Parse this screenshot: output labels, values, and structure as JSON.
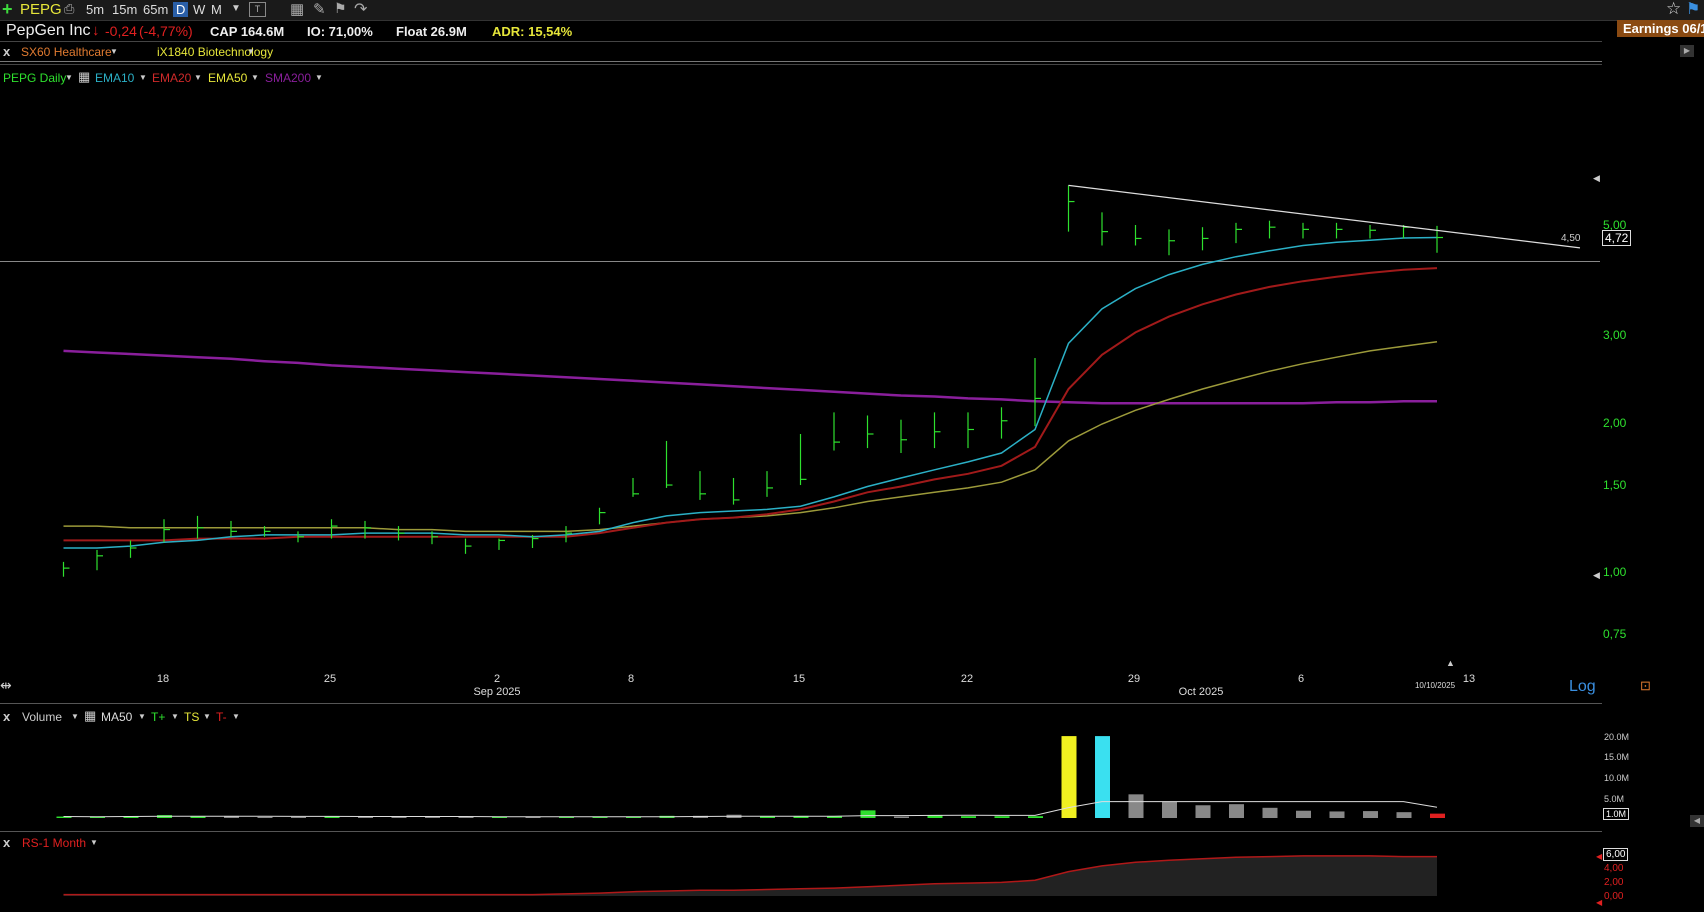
{
  "toolbar": {
    "symbol": "PEPG",
    "intervals": [
      "5m",
      "15m",
      "65m",
      "D",
      "W",
      "M"
    ],
    "active_interval": "D"
  },
  "header": {
    "company": "PepGen Inc",
    "change": "-0,24",
    "change_pct": "(-4,77%)",
    "cap": "CAP 164.6M",
    "io": "IO: 71,00%",
    "float": "Float 26.9M",
    "adr": "ADR: 15,54%",
    "earnings": "Earnings 06/1"
  },
  "sectors": {
    "close": "x",
    "sector": "SX60 Healthcare",
    "industry": "iX1840 Biotechnology"
  },
  "indicators": {
    "main": "PEPG Daily",
    "ema10": "EMA10",
    "ema20": "EMA20",
    "ema50": "EMA50",
    "sma200": "SMA200"
  },
  "price_axis": {
    "ticks": [
      "5,00",
      "3,00",
      "2,00",
      "1,50",
      "1,00",
      "0,75"
    ],
    "last_price": "4,72",
    "trendline_label": "4,50",
    "scale": "Log"
  },
  "date_axis": {
    "ticks": [
      "18",
      "25",
      "2",
      "8",
      "15",
      "22",
      "29",
      "6",
      "13"
    ],
    "months": [
      "Sep 2025",
      "Oct 2025"
    ],
    "cursor_date": "10/10/2025"
  },
  "volume_panel": {
    "close": "x",
    "title": "Volume",
    "ma": "MA50",
    "t_plus": "T+",
    "ts": "TS",
    "t_minus": "T-",
    "ticks": [
      "20.0M",
      "15.0M",
      "10.0M",
      "5.0M"
    ],
    "last_volume": "1.0M"
  },
  "rs_panel": {
    "close": "x",
    "title": "RS-1 Month",
    "ticks": [
      "4,00",
      "2,00",
      "0,00"
    ],
    "last_value": "6,00"
  },
  "colors": {
    "bar": "#2ee02e",
    "ema10": "#2bb0c6",
    "ema20": "#a11a1a",
    "ema50": "#9c9a3a",
    "sma200": "#8a1f9c"
  },
  "chart_data": {
    "type": "ohlc",
    "title": "PEPG Daily",
    "y_scale": "log",
    "ylim": [
      0.65,
      6.5
    ],
    "dates": [
      "Aug 13",
      "Aug 14",
      "Aug 15",
      "Aug 18",
      "Aug 19",
      "Aug 20",
      "Aug 21",
      "Aug 22",
      "Aug 25",
      "Aug 26",
      "Aug 27",
      "Aug 28",
      "Aug 29",
      "Sep 2",
      "Sep 3",
      "Sep 4",
      "Sep 5",
      "Sep 8",
      "Sep 9",
      "Sep 10",
      "Sep 11",
      "Sep 12",
      "Sep 15",
      "Sep 16",
      "Sep 17",
      "Sep 18",
      "Sep 19",
      "Sep 22",
      "Sep 23",
      "Sep 24",
      "Sep 25",
      "Sep 26",
      "Sep 29",
      "Sep 30",
      "Oct 1",
      "Oct 2",
      "Oct 3",
      "Oct 6",
      "Oct 7",
      "Oct 8",
      "Oct 9",
      "Oct 10"
    ],
    "high": [
      1.06,
      1.12,
      1.17,
      1.29,
      1.31,
      1.28,
      1.25,
      1.22,
      1.29,
      1.28,
      1.25,
      1.22,
      1.18,
      1.18,
      1.2,
      1.25,
      1.36,
      1.56,
      1.85,
      1.61,
      1.56,
      1.61,
      1.91,
      2.11,
      2.08,
      2.04,
      2.11,
      2.11,
      2.16,
      2.71,
      6.0,
      5.3,
      5.0,
      4.9,
      4.95,
      5.05,
      5.1,
      5.05,
      5.05,
      5.0,
      5.0,
      4.98
    ],
    "low": [
      0.99,
      1.02,
      1.08,
      1.16,
      1.18,
      1.19,
      1.19,
      1.16,
      1.18,
      1.18,
      1.17,
      1.15,
      1.1,
      1.12,
      1.13,
      1.16,
      1.26,
      1.43,
      1.49,
      1.41,
      1.38,
      1.43,
      1.51,
      1.77,
      1.79,
      1.75,
      1.79,
      1.79,
      1.87,
      1.98,
      4.85,
      4.55,
      4.55,
      4.35,
      4.45,
      4.6,
      4.7,
      4.7,
      4.7,
      4.7,
      4.7,
      4.4
    ],
    "close": [
      1.03,
      1.09,
      1.13,
      1.23,
      1.24,
      1.22,
      1.22,
      1.19,
      1.25,
      1.24,
      1.21,
      1.19,
      1.14,
      1.17,
      1.18,
      1.21,
      1.33,
      1.45,
      1.51,
      1.45,
      1.41,
      1.49,
      1.55,
      1.84,
      1.91,
      1.86,
      1.93,
      1.95,
      2.03,
      2.25,
      5.57,
      4.85,
      4.7,
      4.65,
      4.7,
      4.9,
      4.95,
      4.9,
      4.9,
      4.88,
      4.95,
      4.72
    ],
    "ema10": [
      1.13,
      1.13,
      1.14,
      1.16,
      1.17,
      1.19,
      1.2,
      1.2,
      1.2,
      1.21,
      1.21,
      1.21,
      1.2,
      1.2,
      1.19,
      1.2,
      1.22,
      1.27,
      1.31,
      1.33,
      1.34,
      1.35,
      1.37,
      1.43,
      1.5,
      1.56,
      1.62,
      1.68,
      1.75,
      1.95,
      2.9,
      3.4,
      3.73,
      3.98,
      4.17,
      4.32,
      4.44,
      4.55,
      4.62,
      4.66,
      4.71,
      4.72
    ],
    "ema20": [
      1.17,
      1.17,
      1.17,
      1.17,
      1.18,
      1.18,
      1.18,
      1.19,
      1.19,
      1.19,
      1.19,
      1.19,
      1.19,
      1.19,
      1.19,
      1.19,
      1.21,
      1.24,
      1.27,
      1.29,
      1.3,
      1.32,
      1.35,
      1.4,
      1.46,
      1.5,
      1.55,
      1.59,
      1.65,
      1.8,
      2.35,
      2.75,
      3.05,
      3.28,
      3.47,
      3.63,
      3.76,
      3.86,
      3.94,
      4.01,
      4.07,
      4.1
    ],
    "ema50": [
      1.25,
      1.25,
      1.24,
      1.24,
      1.24,
      1.24,
      1.24,
      1.24,
      1.24,
      1.24,
      1.23,
      1.23,
      1.22,
      1.22,
      1.22,
      1.22,
      1.23,
      1.25,
      1.27,
      1.29,
      1.3,
      1.31,
      1.33,
      1.36,
      1.4,
      1.43,
      1.46,
      1.49,
      1.53,
      1.62,
      1.85,
      2.0,
      2.13,
      2.24,
      2.35,
      2.45,
      2.55,
      2.64,
      2.72,
      2.8,
      2.86,
      2.92
    ],
    "sma200": [
      2.8,
      2.78,
      2.76,
      2.74,
      2.72,
      2.7,
      2.67,
      2.65,
      2.62,
      2.6,
      2.58,
      2.56,
      2.54,
      2.52,
      2.5,
      2.48,
      2.46,
      2.44,
      2.42,
      2.4,
      2.38,
      2.36,
      2.34,
      2.32,
      2.3,
      2.28,
      2.27,
      2.25,
      2.24,
      2.22,
      2.21,
      2.2,
      2.2,
      2.2,
      2.2,
      2.2,
      2.2,
      2.2,
      2.21,
      2.21,
      2.22,
      2.22
    ],
    "volume_millions": [
      0.4,
      0.3,
      0.5,
      0.8,
      0.4,
      0.5,
      0.3,
      0.3,
      0.4,
      0.3,
      0.3,
      0.4,
      0.3,
      0.3,
      0.4,
      0.4,
      0.3,
      0.4,
      0.6,
      0.6,
      0.9,
      0.4,
      0.5,
      0.5,
      2.1,
      0.4,
      0.8,
      0.5,
      0.5,
      0.5,
      22.5,
      22.5,
      6.5,
      4.5,
      3.5,
      3.8,
      2.8,
      2.0,
      1.8,
      1.9,
      1.6,
      1.2
    ],
    "volume_up": [
      true,
      true,
      true,
      true,
      true,
      false,
      false,
      false,
      true,
      false,
      false,
      false,
      false,
      true,
      false,
      true,
      true,
      true,
      true,
      false,
      false,
      true,
      true,
      true,
      true,
      false,
      true,
      true,
      true,
      true,
      true,
      false,
      false,
      false,
      false,
      false,
      false,
      false,
      false,
      false,
      false,
      false
    ],
    "rs_values": [
      0.2,
      0.2,
      0.2,
      0.2,
      0.2,
      0.2,
      0.2,
      0.2,
      0.2,
      0.2,
      0.2,
      0.2,
      0.2,
      0.2,
      0.2,
      0.3,
      0.4,
      0.6,
      0.7,
      0.8,
      0.8,
      0.9,
      1.0,
      1.1,
      1.3,
      1.5,
      1.7,
      1.8,
      1.9,
      2.2,
      3.4,
      4.2,
      4.7,
      5.0,
      5.2,
      5.4,
      5.5,
      5.6,
      5.6,
      5.6,
      5.5,
      5.5
    ]
  }
}
